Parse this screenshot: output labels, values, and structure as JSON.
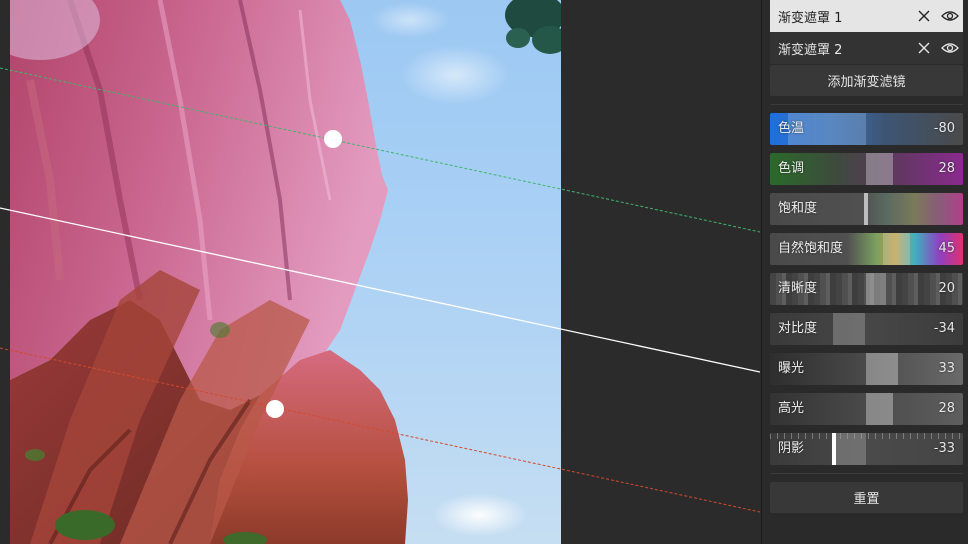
{
  "masks": [
    {
      "label": "渐变遮罩 1",
      "active": true
    },
    {
      "label": "渐变遮罩 2",
      "active": false
    }
  ],
  "add_filter_label": "添加渐变滤镜",
  "sliders": [
    {
      "label": "色温",
      "value": "-80"
    },
    {
      "label": "色调",
      "value": "28"
    },
    {
      "label": "饱和度",
      "value": ""
    },
    {
      "label": "自然饱和度",
      "value": "45"
    },
    {
      "label": "清晰度",
      "value": "20"
    },
    {
      "label": "对比度",
      "value": "-34"
    },
    {
      "label": "曝光",
      "value": "33"
    },
    {
      "label": "高光",
      "value": "28"
    },
    {
      "label": "阴影",
      "value": "-33"
    }
  ],
  "reset_label": "重置",
  "colors": {
    "panel_bg": "#2a2a2a",
    "active_mask_bg": "#e5e5e5",
    "button_bg": "#383838",
    "guide_green": "#3fb56a",
    "guide_white": "#ffffff",
    "guide_red": "#d24a2c"
  },
  "icons": {
    "close": "close-icon",
    "visibility": "eye-icon",
    "handle": "gradient-handle"
  }
}
